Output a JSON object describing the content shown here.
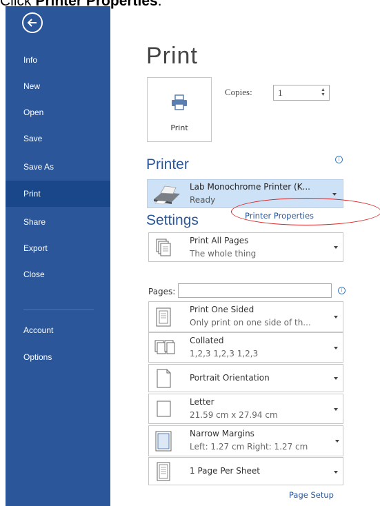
{
  "caption": {
    "prefix": "Click ",
    "bold": "Printer Properties",
    "suffix": "."
  },
  "sidebar": {
    "items": [
      {
        "label": "Info"
      },
      {
        "label": "New"
      },
      {
        "label": "Open"
      },
      {
        "label": "Save"
      },
      {
        "label": "Save As"
      },
      {
        "label": "Print",
        "active": true
      },
      {
        "label": "Share"
      },
      {
        "label": "Export"
      },
      {
        "label": "Close"
      },
      {
        "label": "Account"
      },
      {
        "label": "Options"
      }
    ]
  },
  "main": {
    "title": "Print",
    "print_button_label": "Print",
    "copies_label": "Copies:",
    "copies_value": "1",
    "printer_heading": "Printer",
    "printer": {
      "name": "Lab Monochrome Printer (K...",
      "status": "Ready"
    },
    "printer_properties_link": "Printer Properties",
    "settings_heading": "Settings",
    "pages_label": "Pages:",
    "pages_value": "",
    "settings": [
      {
        "line1": "Print All Pages",
        "line2": "The whole thing",
        "icon": "pages-icon"
      },
      {
        "line1": "Print One Sided",
        "line2": "Only print on one side of th...",
        "icon": "one-sided-icon"
      },
      {
        "line1": "Collated",
        "line2": "1,2,3   1,2,3   1,2,3",
        "icon": "collated-icon"
      },
      {
        "line1": "Portrait Orientation",
        "line2": "",
        "icon": "portrait-icon"
      },
      {
        "line1": "Letter",
        "line2": "21.59 cm x 27.94 cm",
        "icon": "paper-size-icon"
      },
      {
        "line1": "Narrow Margins",
        "line2": "Left: 1.27 cm   Right: 1.27 cm",
        "icon": "margins-icon"
      },
      {
        "line1": "1 Page Per Sheet",
        "line2": "",
        "icon": "pages-per-sheet-icon"
      }
    ],
    "page_setup_link": "Page Setup"
  },
  "colors": {
    "sidebar": "#2b579a",
    "sidebar_active": "#19478a",
    "accent": "#2b579a",
    "printer_highlight": "#cde2f6",
    "annotation": "#dd2222"
  }
}
